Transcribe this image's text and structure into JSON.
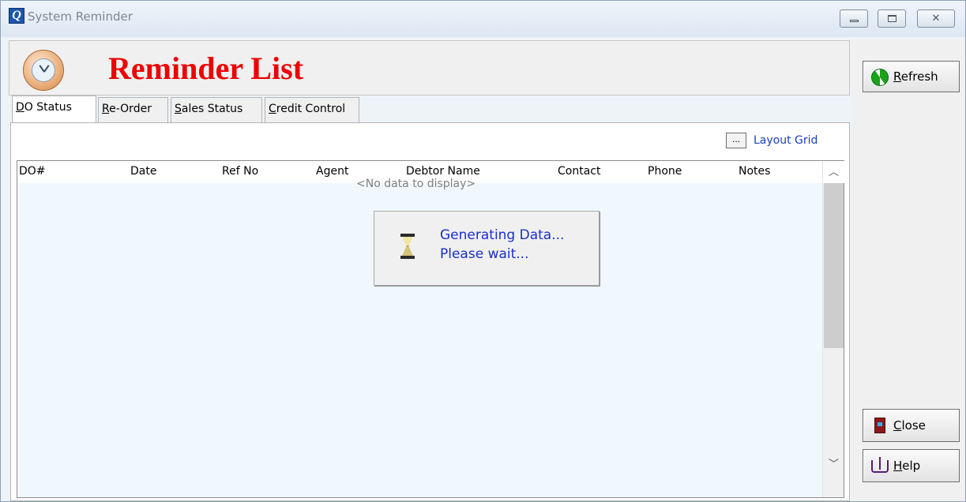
{
  "window": {
    "title": "System Reminder",
    "app_icon": "Q"
  },
  "header": {
    "title": "Reminder List",
    "title_color": "#ee0000",
    "icon": "clock-icon"
  },
  "tabs": [
    {
      "mnemonic": "D",
      "rest": "O Status",
      "active": true
    },
    {
      "mnemonic": "R",
      "rest": "e-Order",
      "active": false
    },
    {
      "mnemonic": "S",
      "rest": "ales Status",
      "active": false
    },
    {
      "mnemonic": "C",
      "rest": "redit Control",
      "active": false
    }
  ],
  "layout_grid": {
    "button_label": "...",
    "label": "Layout Grid"
  },
  "grid": {
    "columns": [
      "DO#",
      "Date",
      "Ref No",
      "Agent",
      "Debtor Name",
      "Contact",
      "Phone",
      "Notes"
    ],
    "empty_text": "<No data to display>"
  },
  "wait_dialog": {
    "line1": "Generating Data...",
    "line2": "Please wait...",
    "icon": "hourglass-icon"
  },
  "side_buttons": {
    "refresh": {
      "mnemonic": "R",
      "rest": "efresh",
      "icon": "refresh-icon"
    },
    "close": {
      "mnemonic": "C",
      "rest": "lose",
      "icon": "door-icon"
    },
    "help": {
      "mnemonic": "H",
      "rest": "elp",
      "icon": "book-icon"
    }
  },
  "colors": {
    "accent_link": "#1a3fc0",
    "wait_text": "#1a2fcc",
    "grid_background": "#f0f8fd"
  }
}
